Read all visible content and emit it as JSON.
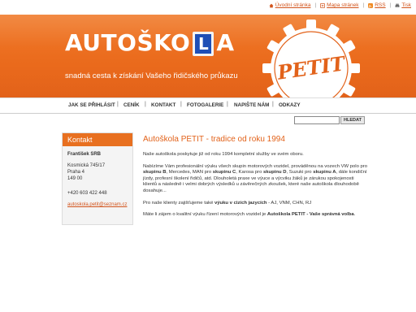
{
  "toplinks": {
    "home": "Úvodní stránka",
    "sitemap": "Mapa stránek",
    "rss": "RSS",
    "print": "Tisk"
  },
  "header": {
    "logo_left": "AUTOŠKO",
    "logo_sign": "L",
    "logo_right": "A",
    "slogan": "snadná cesta k získání Vašeho řidičského průkazu",
    "emblem_text": "PETIT",
    "colors": {
      "banner": "#ea6a1c",
      "sign": "#1f4fb6"
    }
  },
  "nav": {
    "items": [
      "JAK SE PŘIHLÁSIT",
      "CENÍK",
      "KONTAKT",
      "FOTOGALERIE",
      "NAPIŠTE NÁM",
      "ODKAZY"
    ]
  },
  "search": {
    "value": "",
    "button": "HLEDAT"
  },
  "sidebar": {
    "title": "Kontakt",
    "name": "František SRB",
    "street": "Kosmická 745/17",
    "city": "Praha 4",
    "zip": "149 00",
    "phone": "+420 603 422 448",
    "email": "autoskola.petit@seznam.cz"
  },
  "main": {
    "title": "Autoškola PETIT - tradice od roku 1994",
    "p1": "Naše autoškola poskytuje již od roku 1994 kompletní služby ve svém oboru.",
    "p2": {
      "t1": "Nabízíme Vám profesionální výuku všech skupin motorových vozidel, prováděnou na vozech VW polo pro ",
      "b1": "skupinu B",
      "t2": ", Mercedes, MAN pro ",
      "b2": "skupinu C",
      "t3": ", Karosa pro ",
      "b3": "skupinu D",
      "t4": ", Suzuki pro ",
      "b4": "skupinu A",
      "t5": ", dále kondiční jízdy, profesní školení řidičů, atd. Dlouholetá praxe ve výuce a výcviku žáků je zárukou spokojenosti klientů a následně i velmi dobrých výsledků u závěrečných zkoušek, které naše autoškola dlouhodobě dosahuje..."
    },
    "p3": {
      "t1": "Pro naše klienty zajišťujeme také ",
      "b1": "výuku v cizích jazycích",
      "t2": " - AJ, VNM, CHN, RJ"
    },
    "p4": {
      "t1": "Máte li zájem o kvalitní výuku řízení motorových vozidel je ",
      "b1": "Autoškola PETIT - Vaše správná volba",
      "t2": "."
    }
  }
}
